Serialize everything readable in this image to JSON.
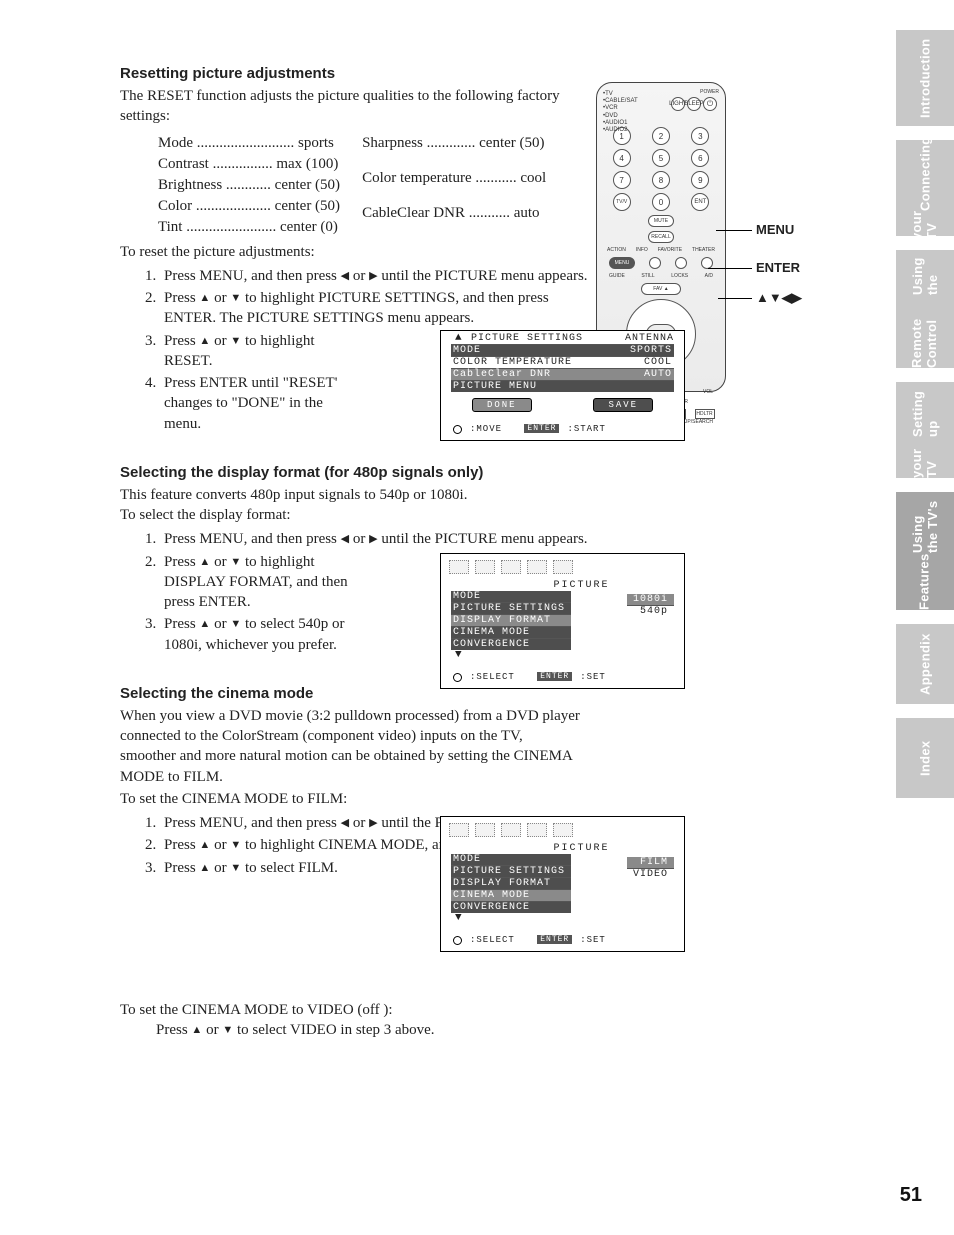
{
  "page_number": "51",
  "tabs": [
    {
      "l1": "Introduction",
      "l2": ""
    },
    {
      "l1": "Connecting",
      "l2": "your TV"
    },
    {
      "l1": "Using the",
      "l2": "Remote Control"
    },
    {
      "l1": "Setting up",
      "l2": "your TV"
    },
    {
      "l1": "Using the TV's",
      "l2": "Features"
    },
    {
      "l1": "Appendix",
      "l2": ""
    },
    {
      "l1": "Index",
      "l2": ""
    }
  ],
  "remote_callouts": {
    "menu": "MENU",
    "enter": "ENTER",
    "arrows": "▲▼◀▶"
  },
  "s1": {
    "heading": "Resetting picture adjustments",
    "intro": "The RESET function adjusts the picture qualities to the following factory settings:",
    "defaults_left": [
      [
        "Mode",
        "sports"
      ],
      [
        "Contrast",
        "max (100)"
      ],
      [
        "Brightness",
        "center (50)"
      ],
      [
        "Color",
        "center (50)"
      ],
      [
        "Tint",
        "center (0)"
      ]
    ],
    "defaults_right": [
      [
        "Sharpness",
        "center (50)"
      ],
      [
        "Color temperature",
        "cool"
      ],
      [
        "CableClear DNR",
        "auto"
      ]
    ],
    "lead": "To reset the picture adjustments:",
    "step1_pre": "Press MENU, and then press ",
    "step1_post": " until the PICTURE menu appears.",
    "step2_pre": "Press ",
    "step2_post": " to highlight PICTURE SETTINGS, and then press ENTER. The PICTURE SETTINGS menu appears.",
    "step3_pre": "Press ",
    "step3_post": " to highlight RESET.",
    "step4": "Press ENTER until \"RESET' changes to \"DONE\" in the menu."
  },
  "osd1": {
    "title": "PICTURE SETTINGS",
    "right": "ANTENNA",
    "rows": [
      [
        "MODE",
        "SPORTS"
      ],
      [
        "COLOR TEMPERATURE",
        "COOL"
      ],
      [
        "CableClear DNR",
        "AUTO"
      ],
      [
        "PICTURE MENU",
        ""
      ]
    ],
    "btn1": "DONE",
    "btn2": "SAVE",
    "foot_left": ":MOVE",
    "foot_key": "ENTER",
    "foot_right": ":START"
  },
  "s2": {
    "heading": "Selecting the display format (for 480p signals only)",
    "intro": "This feature converts 480p input signals to 540p or 1080i.",
    "lead": "To select the display format:",
    "step1_pre": "Press MENU, and then press ",
    "step1_post": " until the PICTURE menu appears.",
    "step2_pre": "Press ",
    "step2_post": " to highlight DISPLAY FORMAT, and then press ENTER.",
    "step3_pre": "Press ",
    "step3_post": " to select 540p or 1080i, whichever you prefer."
  },
  "osd2": {
    "title": "PICTURE",
    "rows": [
      [
        "MODE",
        ""
      ],
      [
        "PICTURE SETTINGS",
        ""
      ],
      [
        "DISPLAY FORMAT",
        ""
      ],
      [
        "CINEMA MODE",
        ""
      ],
      [
        "CONVERGENCE",
        ""
      ]
    ],
    "opts": [
      "1080i",
      "540p"
    ],
    "foot_left": ":SELECT",
    "foot_key": "ENTER",
    "foot_right": ":SET"
  },
  "s3": {
    "heading": "Selecting the cinema mode",
    "intro": "When you view a DVD movie (3:2 pulldown processed) from a DVD player connected to the ColorStream (component video) inputs on the TV, smoother and more natural motion can be obtained by setting the CINEMA MODE to FILM.",
    "lead": "To set the CINEMA MODE to FILM:",
    "step1_pre": "Press MENU, and then press ",
    "step1_post": " until the PICTURE menu appears.",
    "step2_pre": "Press ",
    "step2_post": " to highlight CINEMA MODE, and then press ENTER.",
    "step3_pre": "Press ",
    "step3_post": " to select FILM."
  },
  "osd3": {
    "title": "PICTURE",
    "rows": [
      [
        "MODE",
        ""
      ],
      [
        "PICTURE SETTINGS",
        ""
      ],
      [
        "DISPLAY FORMAT",
        ""
      ],
      [
        "CINEMA MODE",
        ""
      ],
      [
        "CONVERGENCE",
        ""
      ]
    ],
    "opts": [
      "FILM",
      "VIDEO"
    ],
    "foot_left": ":SELECT",
    "foot_key": "ENTER",
    "foot_right": ":SET"
  },
  "s4": {
    "lead": "To set the CINEMA MODE to VIDEO (off ):",
    "step_pre": "Press ",
    "step_post": " to select VIDEO in step 3 above."
  },
  "glyph": {
    "left": "◀",
    "right": "▶",
    "up": "▲",
    "down": "▼",
    "or": "or"
  }
}
